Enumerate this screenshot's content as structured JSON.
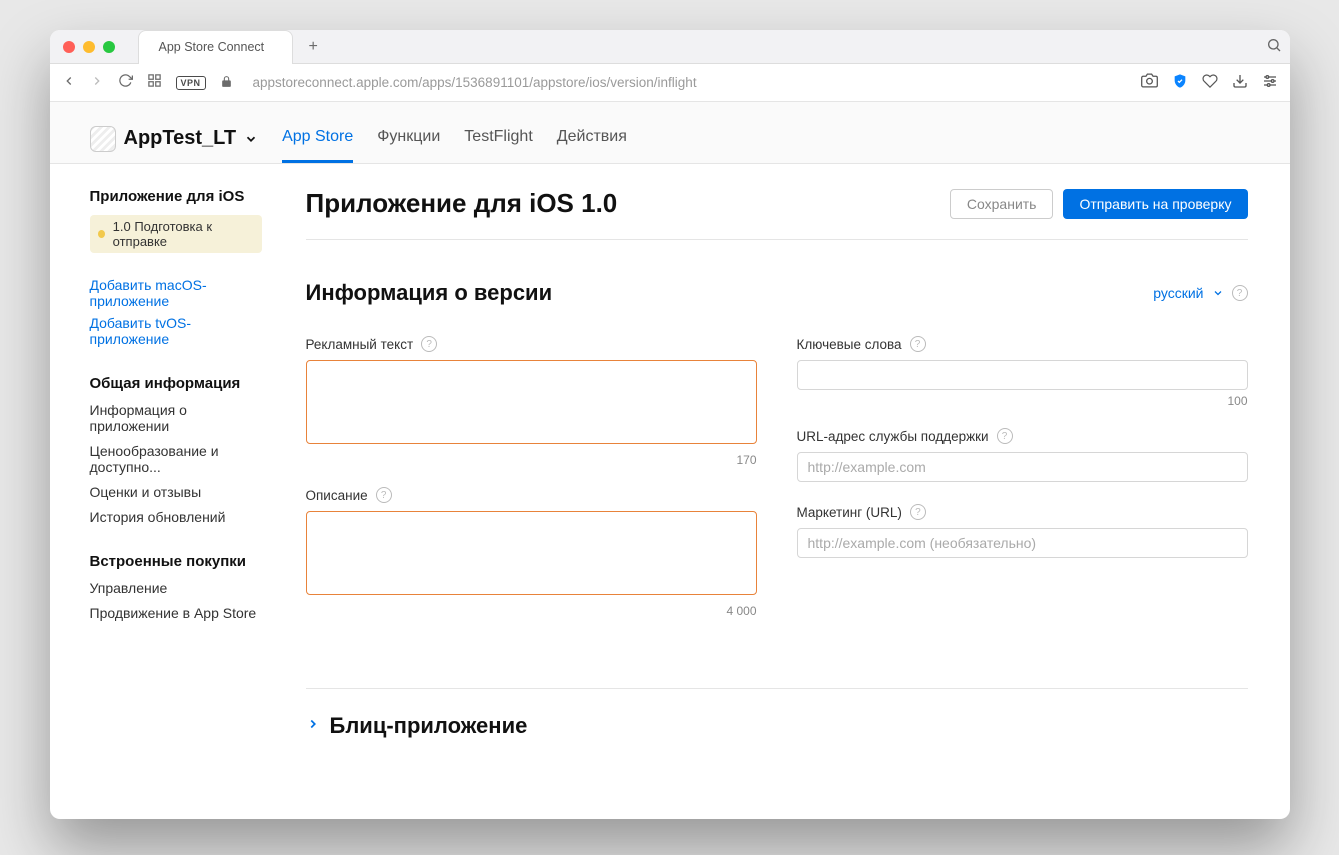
{
  "browser": {
    "tabTitle": "App Store Connect",
    "url": "appstoreconnect.apple.com/apps/1536891101/appstore/ios/version/inflight",
    "vpn": "VPN"
  },
  "header": {
    "appName": "AppTest_LT",
    "tabs": [
      "App Store",
      "Функции",
      "TestFlight",
      "Действия"
    ]
  },
  "sidebar": {
    "iosTitle": "Приложение для iOS",
    "statusVersion": "1.0 Подготовка к отправке",
    "addLinks": [
      "Добавить macOS-приложение",
      "Добавить tvOS-приложение"
    ],
    "generalTitle": "Общая информация",
    "generalItems": [
      "Информация о приложении",
      "Ценообразование и доступно...",
      "Оценки и отзывы",
      "История обновлений"
    ],
    "iapTitle": "Встроенные покупки",
    "iapItems": [
      "Управление",
      "Продвижение в App Store"
    ]
  },
  "main": {
    "pageTitle": "Приложение для iOS 1.0",
    "btnSave": "Сохранить",
    "btnSubmit": "Отправить на проверку",
    "sectionTitle": "Информация о версии",
    "language": "русский",
    "fields": {
      "promoLabel": "Рекламный текст",
      "promoCount": "170",
      "descLabel": "Описание",
      "descCount": "4 000",
      "keywordsLabel": "Ключевые слова",
      "keywordsCount": "100",
      "supportLabel": "URL-адрес службы поддержки",
      "supportPh": "http://example.com",
      "marketingLabel": "Маркетинг (URL)",
      "marketingPh": "http://example.com (необязательно)"
    },
    "collapseTitle": "Блиц-приложение"
  }
}
